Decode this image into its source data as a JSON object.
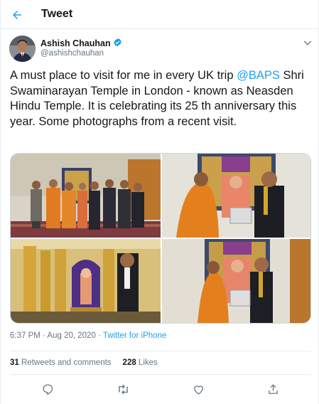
{
  "header": {
    "title": "Tweet"
  },
  "author": {
    "name": "Ashish Chauhan",
    "handle": "@ashishchauhan"
  },
  "tweet": {
    "text_before": "A must place to visit for me in every UK trip ",
    "mention": "@BAPS",
    "text_after": " Shri Swaminarayan Temple in London - known as Neasden Hindu Temple.  It is celebrating its 25 th anniversary this year. Some photographs from a recent visit."
  },
  "meta": {
    "time": "6:37 PM · Aug 20, 2020 · ",
    "source": "Twitter for iPhone"
  },
  "stats": {
    "retweets_count": "31",
    "retweets_label": " Retweets and comments",
    "likes_count": "228",
    "likes_label": " Likes"
  },
  "colors": {
    "link": "#1da1f2",
    "secondary": "#657786",
    "border": "#e6ecf0",
    "verified": "#1da1f2"
  },
  "icons": [
    "back-arrow-icon",
    "verified-badge-icon",
    "chevron-down-icon",
    "reply-icon",
    "retweet-icon",
    "like-icon",
    "share-icon"
  ]
}
